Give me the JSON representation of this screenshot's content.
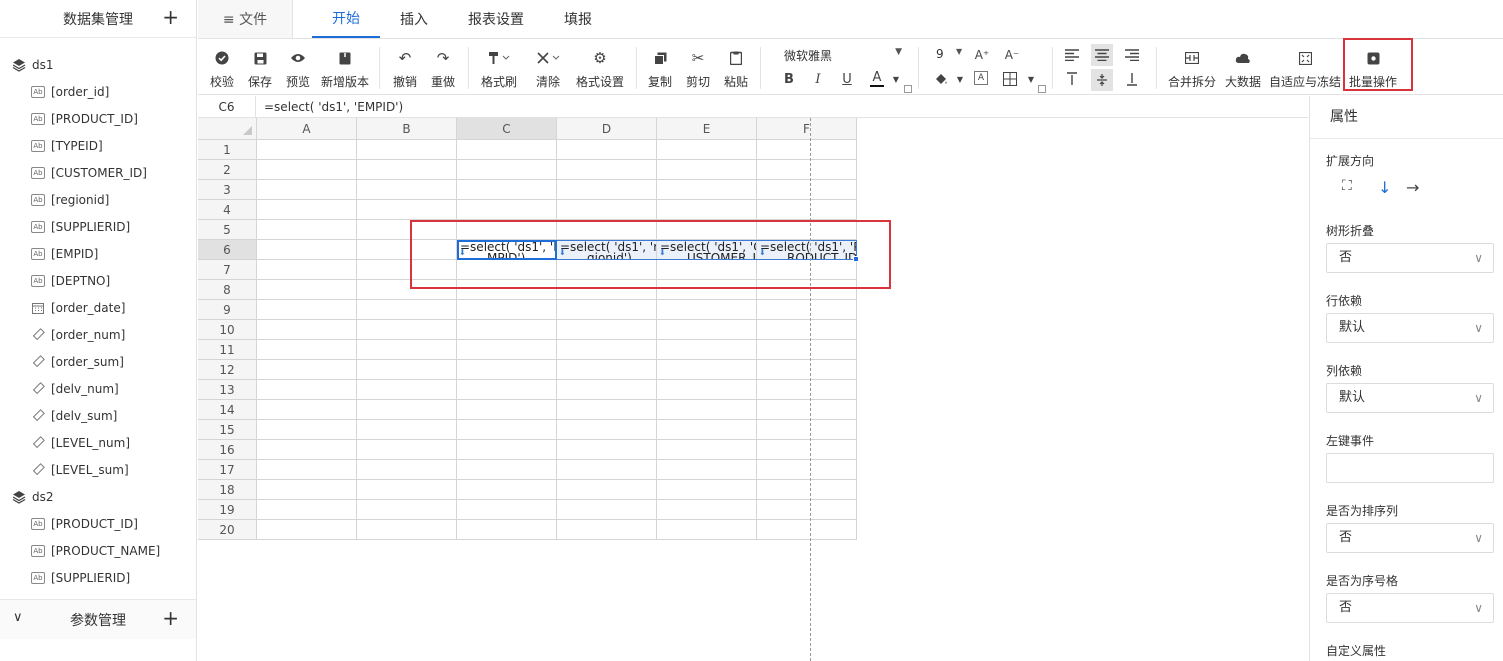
{
  "sidebar": {
    "title": "数据集管理",
    "add_icon": "+",
    "datasets": [
      {
        "name": "ds1",
        "fields": [
          {
            "label": "[order_id]",
            "type": "text"
          },
          {
            "label": "[PRODUCT_ID]",
            "type": "text"
          },
          {
            "label": "[TYPEID]",
            "type": "text"
          },
          {
            "label": "[CUSTOMER_ID]",
            "type": "text"
          },
          {
            "label": "[regionid]",
            "type": "text"
          },
          {
            "label": "[SUPPLIERID]",
            "type": "text"
          },
          {
            "label": "[EMPID]",
            "type": "text"
          },
          {
            "label": "[DEPTNO]",
            "type": "text"
          },
          {
            "label": "[order_date]",
            "type": "date"
          },
          {
            "label": "[order_num]",
            "type": "number"
          },
          {
            "label": "[order_sum]",
            "type": "number"
          },
          {
            "label": "[delv_num]",
            "type": "number"
          },
          {
            "label": "[delv_sum]",
            "type": "number"
          },
          {
            "label": "[LEVEL_num]",
            "type": "number"
          },
          {
            "label": "[LEVEL_sum]",
            "type": "number"
          }
        ]
      },
      {
        "name": "ds2",
        "fields": [
          {
            "label": "[PRODUCT_ID]",
            "type": "text"
          },
          {
            "label": "[PRODUCT_NAME]",
            "type": "text"
          },
          {
            "label": "[SUPPLIERID]",
            "type": "text"
          }
        ]
      }
    ],
    "footer": {
      "title": "参数管理",
      "add_icon": "+",
      "collapse_icon": "chevron-down-icon"
    }
  },
  "menu": {
    "file": "≡ 文件",
    "tabs": [
      "开始",
      "插入",
      "报表设置",
      "填报"
    ],
    "active_tab": "开始"
  },
  "toolbar": {
    "validate": "校验",
    "save": "保存",
    "preview": "预览",
    "new_version": "新增版本",
    "undo": "撤销",
    "redo": "重做",
    "format_brush": "格式刷",
    "clear": "清除",
    "format_settings": "格式设置",
    "copy": "复制",
    "cut": "剪切",
    "paste": "粘贴",
    "font_name": "微软雅黑",
    "font_size": "9",
    "merge_split": "合并拆分",
    "big_data": "大数据",
    "autofit_freeze": "自适应与冻结",
    "batch_ops": "批量操作",
    "accent_color": "#d9333b"
  },
  "formula_bar": {
    "cell_ref": "C6",
    "formula": "=select( 'ds1', 'EMPID')"
  },
  "grid": {
    "columns": [
      "A",
      "B",
      "C",
      "D",
      "E",
      "F"
    ],
    "rows": [
      "1",
      "2",
      "3",
      "4",
      "5",
      "6",
      "7",
      "8",
      "9",
      "10",
      "11",
      "12",
      "13",
      "14",
      "15",
      "16",
      "17",
      "18",
      "19",
      "20"
    ],
    "cells": {
      "C6": {
        "line1": "=select( 'ds1', 'E",
        "line2": "MPID')"
      },
      "D6": {
        "line1": "=select( 'ds1', 're",
        "line2": "gionid')"
      },
      "E6": {
        "line1": "=select( 'ds1', 'C",
        "line2": "USTOMER_ID')"
      },
      "F6": {
        "line1": "=select( 'ds1', 'P",
        "line2": "RODUCT_ID')"
      }
    },
    "selection_color": "#1f6dd8"
  },
  "panel": {
    "title": "属性",
    "expand_direction_label": "扩展方向",
    "tree_collapse_label": "树形折叠",
    "tree_collapse_value": "否",
    "row_dep_label": "行依赖",
    "row_dep_value": "默认",
    "col_dep_label": "列依赖",
    "col_dep_value": "默认",
    "left_click_label": "左键事件",
    "left_click_value": "",
    "is_sort_col_label": "是否为排序列",
    "is_sort_col_value": "否",
    "is_seq_cell_label": "是否为序号格",
    "is_seq_cell_value": "否",
    "custom_attr_label": "自定义属性"
  }
}
